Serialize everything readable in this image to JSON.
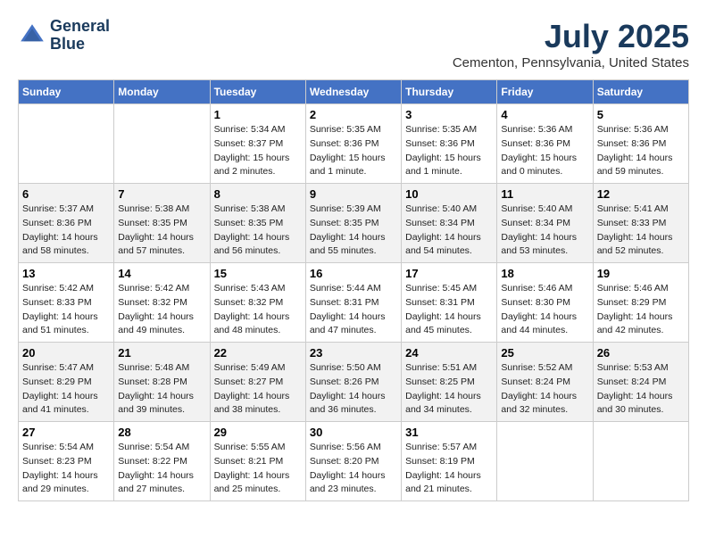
{
  "header": {
    "logo_line1": "General",
    "logo_line2": "Blue",
    "month": "July 2025",
    "location": "Cementon, Pennsylvania, United States"
  },
  "days_of_week": [
    "Sunday",
    "Monday",
    "Tuesday",
    "Wednesday",
    "Thursday",
    "Friday",
    "Saturday"
  ],
  "weeks": [
    [
      {
        "day": "",
        "info": ""
      },
      {
        "day": "",
        "info": ""
      },
      {
        "day": "1",
        "info": "Sunrise: 5:34 AM\nSunset: 8:37 PM\nDaylight: 15 hours\nand 2 minutes."
      },
      {
        "day": "2",
        "info": "Sunrise: 5:35 AM\nSunset: 8:36 PM\nDaylight: 15 hours\nand 1 minute."
      },
      {
        "day": "3",
        "info": "Sunrise: 5:35 AM\nSunset: 8:36 PM\nDaylight: 15 hours\nand 1 minute."
      },
      {
        "day": "4",
        "info": "Sunrise: 5:36 AM\nSunset: 8:36 PM\nDaylight: 15 hours\nand 0 minutes."
      },
      {
        "day": "5",
        "info": "Sunrise: 5:36 AM\nSunset: 8:36 PM\nDaylight: 14 hours\nand 59 minutes."
      }
    ],
    [
      {
        "day": "6",
        "info": "Sunrise: 5:37 AM\nSunset: 8:36 PM\nDaylight: 14 hours\nand 58 minutes."
      },
      {
        "day": "7",
        "info": "Sunrise: 5:38 AM\nSunset: 8:35 PM\nDaylight: 14 hours\nand 57 minutes."
      },
      {
        "day": "8",
        "info": "Sunrise: 5:38 AM\nSunset: 8:35 PM\nDaylight: 14 hours\nand 56 minutes."
      },
      {
        "day": "9",
        "info": "Sunrise: 5:39 AM\nSunset: 8:35 PM\nDaylight: 14 hours\nand 55 minutes."
      },
      {
        "day": "10",
        "info": "Sunrise: 5:40 AM\nSunset: 8:34 PM\nDaylight: 14 hours\nand 54 minutes."
      },
      {
        "day": "11",
        "info": "Sunrise: 5:40 AM\nSunset: 8:34 PM\nDaylight: 14 hours\nand 53 minutes."
      },
      {
        "day": "12",
        "info": "Sunrise: 5:41 AM\nSunset: 8:33 PM\nDaylight: 14 hours\nand 52 minutes."
      }
    ],
    [
      {
        "day": "13",
        "info": "Sunrise: 5:42 AM\nSunset: 8:33 PM\nDaylight: 14 hours\nand 51 minutes."
      },
      {
        "day": "14",
        "info": "Sunrise: 5:42 AM\nSunset: 8:32 PM\nDaylight: 14 hours\nand 49 minutes."
      },
      {
        "day": "15",
        "info": "Sunrise: 5:43 AM\nSunset: 8:32 PM\nDaylight: 14 hours\nand 48 minutes."
      },
      {
        "day": "16",
        "info": "Sunrise: 5:44 AM\nSunset: 8:31 PM\nDaylight: 14 hours\nand 47 minutes."
      },
      {
        "day": "17",
        "info": "Sunrise: 5:45 AM\nSunset: 8:31 PM\nDaylight: 14 hours\nand 45 minutes."
      },
      {
        "day": "18",
        "info": "Sunrise: 5:46 AM\nSunset: 8:30 PM\nDaylight: 14 hours\nand 44 minutes."
      },
      {
        "day": "19",
        "info": "Sunrise: 5:46 AM\nSunset: 8:29 PM\nDaylight: 14 hours\nand 42 minutes."
      }
    ],
    [
      {
        "day": "20",
        "info": "Sunrise: 5:47 AM\nSunset: 8:29 PM\nDaylight: 14 hours\nand 41 minutes."
      },
      {
        "day": "21",
        "info": "Sunrise: 5:48 AM\nSunset: 8:28 PM\nDaylight: 14 hours\nand 39 minutes."
      },
      {
        "day": "22",
        "info": "Sunrise: 5:49 AM\nSunset: 8:27 PM\nDaylight: 14 hours\nand 38 minutes."
      },
      {
        "day": "23",
        "info": "Sunrise: 5:50 AM\nSunset: 8:26 PM\nDaylight: 14 hours\nand 36 minutes."
      },
      {
        "day": "24",
        "info": "Sunrise: 5:51 AM\nSunset: 8:25 PM\nDaylight: 14 hours\nand 34 minutes."
      },
      {
        "day": "25",
        "info": "Sunrise: 5:52 AM\nSunset: 8:24 PM\nDaylight: 14 hours\nand 32 minutes."
      },
      {
        "day": "26",
        "info": "Sunrise: 5:53 AM\nSunset: 8:24 PM\nDaylight: 14 hours\nand 30 minutes."
      }
    ],
    [
      {
        "day": "27",
        "info": "Sunrise: 5:54 AM\nSunset: 8:23 PM\nDaylight: 14 hours\nand 29 minutes."
      },
      {
        "day": "28",
        "info": "Sunrise: 5:54 AM\nSunset: 8:22 PM\nDaylight: 14 hours\nand 27 minutes."
      },
      {
        "day": "29",
        "info": "Sunrise: 5:55 AM\nSunset: 8:21 PM\nDaylight: 14 hours\nand 25 minutes."
      },
      {
        "day": "30",
        "info": "Sunrise: 5:56 AM\nSunset: 8:20 PM\nDaylight: 14 hours\nand 23 minutes."
      },
      {
        "day": "31",
        "info": "Sunrise: 5:57 AM\nSunset: 8:19 PM\nDaylight: 14 hours\nand 21 minutes."
      },
      {
        "day": "",
        "info": ""
      },
      {
        "day": "",
        "info": ""
      }
    ]
  ]
}
